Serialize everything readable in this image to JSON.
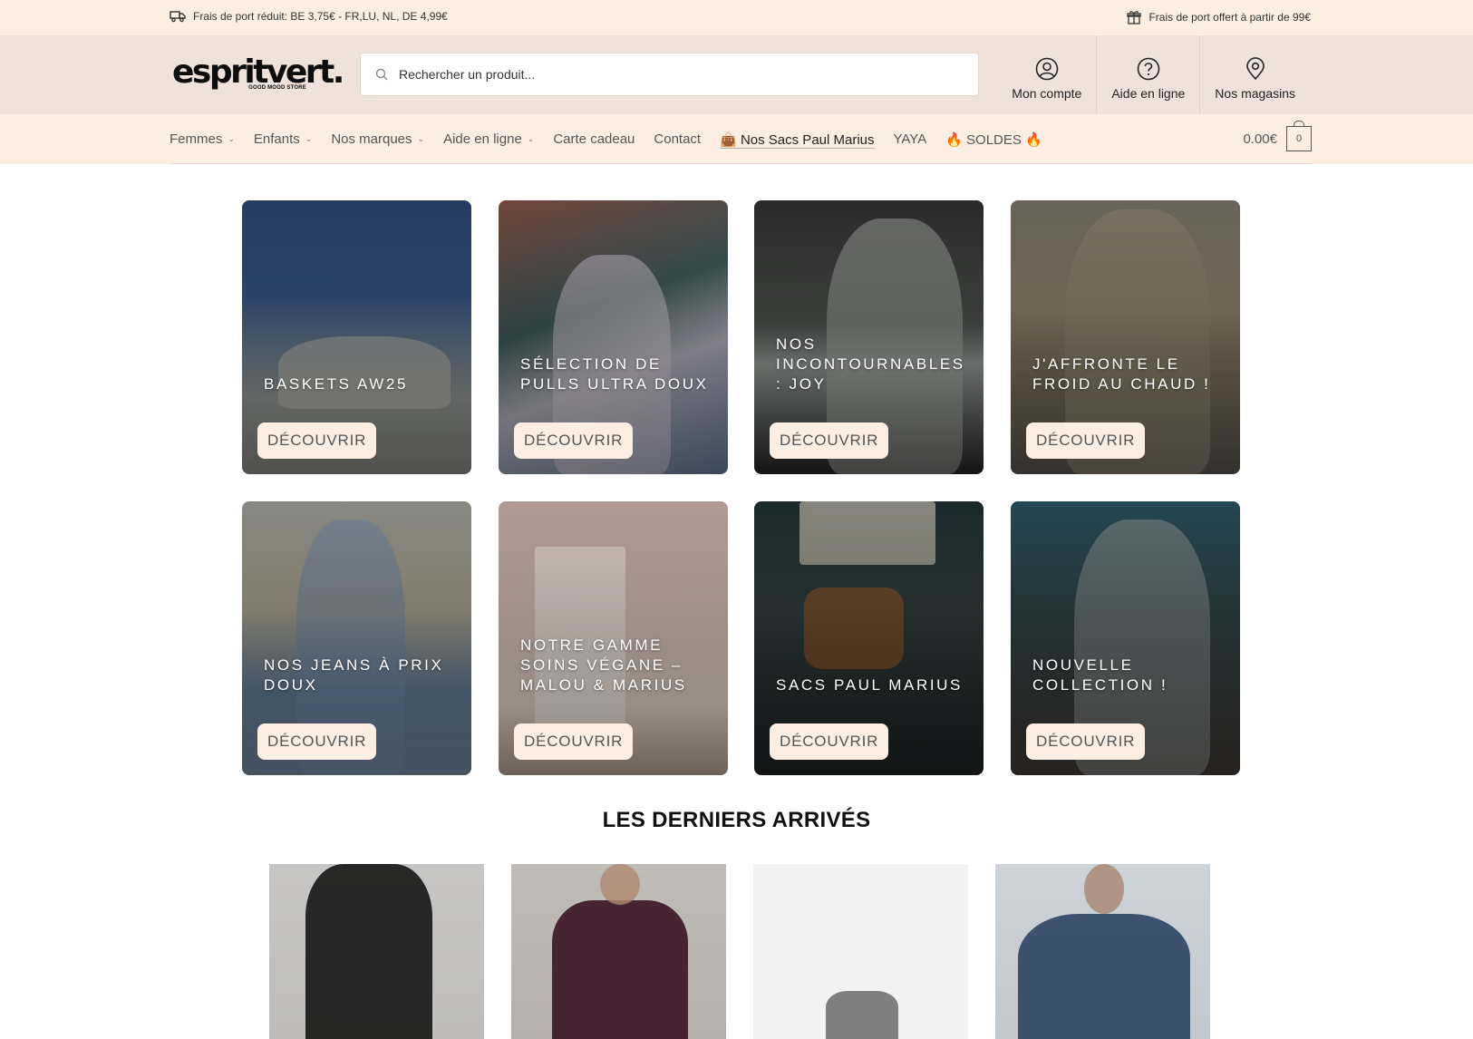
{
  "topbar": {
    "shipping_reduced": "Frais de port réduit: BE 3,75€ - FR,LU, NL, DE 4,99€",
    "shipping_free": "Frais de port offert à partir de 99€"
  },
  "header": {
    "logo_text": "espritvert.",
    "logo_tagline": "GOOD MOOD STORE",
    "search_placeholder": "Rechercher un produit...",
    "links": [
      {
        "label": "Mon compte",
        "icon": "user-icon"
      },
      {
        "label": "Aide en ligne",
        "icon": "help-icon"
      },
      {
        "label": "Nos magasins",
        "icon": "location-pin-icon"
      }
    ]
  },
  "nav": {
    "items": [
      {
        "label": "Femmes",
        "dropdown": true
      },
      {
        "label": "Enfants",
        "dropdown": true
      },
      {
        "label": "Nos marques",
        "dropdown": true
      },
      {
        "label": "Aide en ligne",
        "dropdown": true
      },
      {
        "label": "Carte cadeau",
        "dropdown": false
      },
      {
        "label": "Contact",
        "dropdown": false
      },
      {
        "label": "👜 Nos Sacs Paul Marius",
        "dropdown": false
      },
      {
        "label": "YAYA",
        "dropdown": false
      },
      {
        "label": "🔥 SOLDES 🔥",
        "dropdown": false
      }
    ],
    "cart_amount": "0.00€",
    "cart_count": "0"
  },
  "tiles": [
    {
      "title": "BASKETS AW25",
      "button": "DÉCOUVRIR"
    },
    {
      "title": "SÉLECTION DE PULLS ULTRA DOUX",
      "button": "DÉCOUVRIR"
    },
    {
      "title": "NOS INCONTOURNABLES : JOY",
      "button": "DÉCOUVRIR"
    },
    {
      "title": "J'AFFRONTE LE FROID AU CHAUD !",
      "button": "DÉCOUVRIR"
    },
    {
      "title": "NOS JEANS À PRIX DOUX",
      "button": "DÉCOUVRIR"
    },
    {
      "title": "NOTRE GAMME SOINS VÉGANE – MALOU & MARIUS",
      "button": "DÉCOUVRIR"
    },
    {
      "title": "SACS PAUL MARIUS",
      "button": "DÉCOUVRIR"
    },
    {
      "title": "NOUVELLE COLLECTION !",
      "button": "DÉCOUVRIR"
    }
  ],
  "latest": {
    "title": "LES DERNIERS ARRIVÉS"
  },
  "colors": {
    "topbar_bg": "#fdeee3",
    "header_bg": "#efe2da",
    "button_bg": "#fdeee3"
  }
}
